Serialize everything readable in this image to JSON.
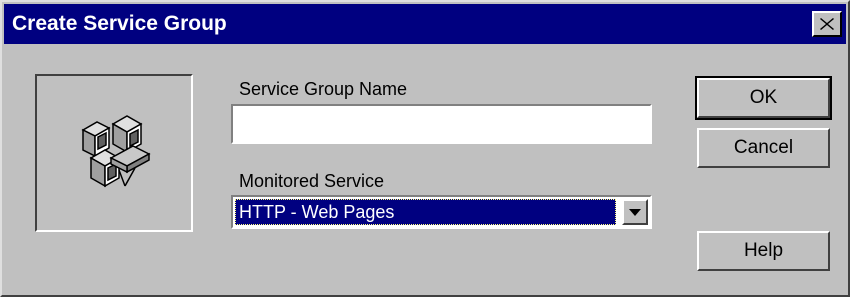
{
  "window": {
    "title": "Create Service Group",
    "close_label": "×"
  },
  "form": {
    "name_label": "Service Group Name",
    "name_value": "",
    "service_label": "Monitored Service",
    "service_selected": "HTTP - Web Pages"
  },
  "buttons": {
    "ok_label": "OK",
    "cancel_label": "Cancel",
    "help_label": "Help"
  },
  "icons": {
    "service_group": "service-group-icon",
    "close": "close-icon",
    "dropdown": "dropdown-arrow-icon"
  },
  "colors": {
    "titlebar": "#000080",
    "face": "#c0c0c0",
    "selection": "#000080"
  }
}
